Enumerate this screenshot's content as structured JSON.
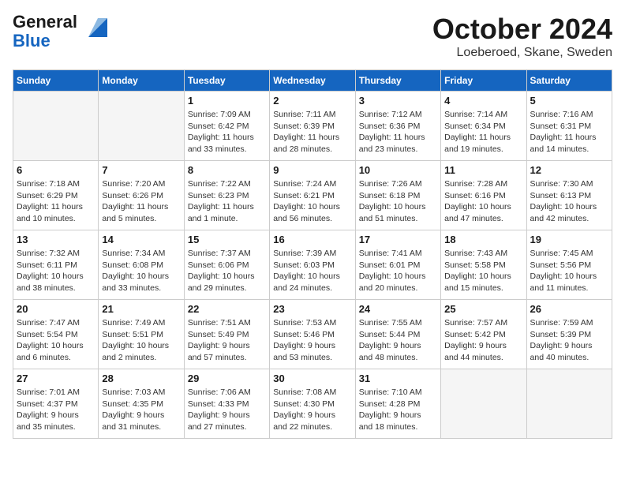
{
  "logo": {
    "line1": "General",
    "line2": "Blue"
  },
  "title": "October 2024",
  "subtitle": "Loeberoed, Skane, Sweden",
  "days_of_week": [
    "Sunday",
    "Monday",
    "Tuesday",
    "Wednesday",
    "Thursday",
    "Friday",
    "Saturday"
  ],
  "weeks": [
    [
      {
        "day": "",
        "info": ""
      },
      {
        "day": "",
        "info": ""
      },
      {
        "day": "1",
        "info": "Sunrise: 7:09 AM\nSunset: 6:42 PM\nDaylight: 11 hours\nand 33 minutes."
      },
      {
        "day": "2",
        "info": "Sunrise: 7:11 AM\nSunset: 6:39 PM\nDaylight: 11 hours\nand 28 minutes."
      },
      {
        "day": "3",
        "info": "Sunrise: 7:12 AM\nSunset: 6:36 PM\nDaylight: 11 hours\nand 23 minutes."
      },
      {
        "day": "4",
        "info": "Sunrise: 7:14 AM\nSunset: 6:34 PM\nDaylight: 11 hours\nand 19 minutes."
      },
      {
        "day": "5",
        "info": "Sunrise: 7:16 AM\nSunset: 6:31 PM\nDaylight: 11 hours\nand 14 minutes."
      }
    ],
    [
      {
        "day": "6",
        "info": "Sunrise: 7:18 AM\nSunset: 6:29 PM\nDaylight: 11 hours\nand 10 minutes."
      },
      {
        "day": "7",
        "info": "Sunrise: 7:20 AM\nSunset: 6:26 PM\nDaylight: 11 hours\nand 5 minutes."
      },
      {
        "day": "8",
        "info": "Sunrise: 7:22 AM\nSunset: 6:23 PM\nDaylight: 11 hours\nand 1 minute."
      },
      {
        "day": "9",
        "info": "Sunrise: 7:24 AM\nSunset: 6:21 PM\nDaylight: 10 hours\nand 56 minutes."
      },
      {
        "day": "10",
        "info": "Sunrise: 7:26 AM\nSunset: 6:18 PM\nDaylight: 10 hours\nand 51 minutes."
      },
      {
        "day": "11",
        "info": "Sunrise: 7:28 AM\nSunset: 6:16 PM\nDaylight: 10 hours\nand 47 minutes."
      },
      {
        "day": "12",
        "info": "Sunrise: 7:30 AM\nSunset: 6:13 PM\nDaylight: 10 hours\nand 42 minutes."
      }
    ],
    [
      {
        "day": "13",
        "info": "Sunrise: 7:32 AM\nSunset: 6:11 PM\nDaylight: 10 hours\nand 38 minutes."
      },
      {
        "day": "14",
        "info": "Sunrise: 7:34 AM\nSunset: 6:08 PM\nDaylight: 10 hours\nand 33 minutes."
      },
      {
        "day": "15",
        "info": "Sunrise: 7:37 AM\nSunset: 6:06 PM\nDaylight: 10 hours\nand 29 minutes."
      },
      {
        "day": "16",
        "info": "Sunrise: 7:39 AM\nSunset: 6:03 PM\nDaylight: 10 hours\nand 24 minutes."
      },
      {
        "day": "17",
        "info": "Sunrise: 7:41 AM\nSunset: 6:01 PM\nDaylight: 10 hours\nand 20 minutes."
      },
      {
        "day": "18",
        "info": "Sunrise: 7:43 AM\nSunset: 5:58 PM\nDaylight: 10 hours\nand 15 minutes."
      },
      {
        "day": "19",
        "info": "Sunrise: 7:45 AM\nSunset: 5:56 PM\nDaylight: 10 hours\nand 11 minutes."
      }
    ],
    [
      {
        "day": "20",
        "info": "Sunrise: 7:47 AM\nSunset: 5:54 PM\nDaylight: 10 hours\nand 6 minutes."
      },
      {
        "day": "21",
        "info": "Sunrise: 7:49 AM\nSunset: 5:51 PM\nDaylight: 10 hours\nand 2 minutes."
      },
      {
        "day": "22",
        "info": "Sunrise: 7:51 AM\nSunset: 5:49 PM\nDaylight: 9 hours\nand 57 minutes."
      },
      {
        "day": "23",
        "info": "Sunrise: 7:53 AM\nSunset: 5:46 PM\nDaylight: 9 hours\nand 53 minutes."
      },
      {
        "day": "24",
        "info": "Sunrise: 7:55 AM\nSunset: 5:44 PM\nDaylight: 9 hours\nand 48 minutes."
      },
      {
        "day": "25",
        "info": "Sunrise: 7:57 AM\nSunset: 5:42 PM\nDaylight: 9 hours\nand 44 minutes."
      },
      {
        "day": "26",
        "info": "Sunrise: 7:59 AM\nSunset: 5:39 PM\nDaylight: 9 hours\nand 40 minutes."
      }
    ],
    [
      {
        "day": "27",
        "info": "Sunrise: 7:01 AM\nSunset: 4:37 PM\nDaylight: 9 hours\nand 35 minutes."
      },
      {
        "day": "28",
        "info": "Sunrise: 7:03 AM\nSunset: 4:35 PM\nDaylight: 9 hours\nand 31 minutes."
      },
      {
        "day": "29",
        "info": "Sunrise: 7:06 AM\nSunset: 4:33 PM\nDaylight: 9 hours\nand 27 minutes."
      },
      {
        "day": "30",
        "info": "Sunrise: 7:08 AM\nSunset: 4:30 PM\nDaylight: 9 hours\nand 22 minutes."
      },
      {
        "day": "31",
        "info": "Sunrise: 7:10 AM\nSunset: 4:28 PM\nDaylight: 9 hours\nand 18 minutes."
      },
      {
        "day": "",
        "info": ""
      },
      {
        "day": "",
        "info": ""
      }
    ]
  ]
}
